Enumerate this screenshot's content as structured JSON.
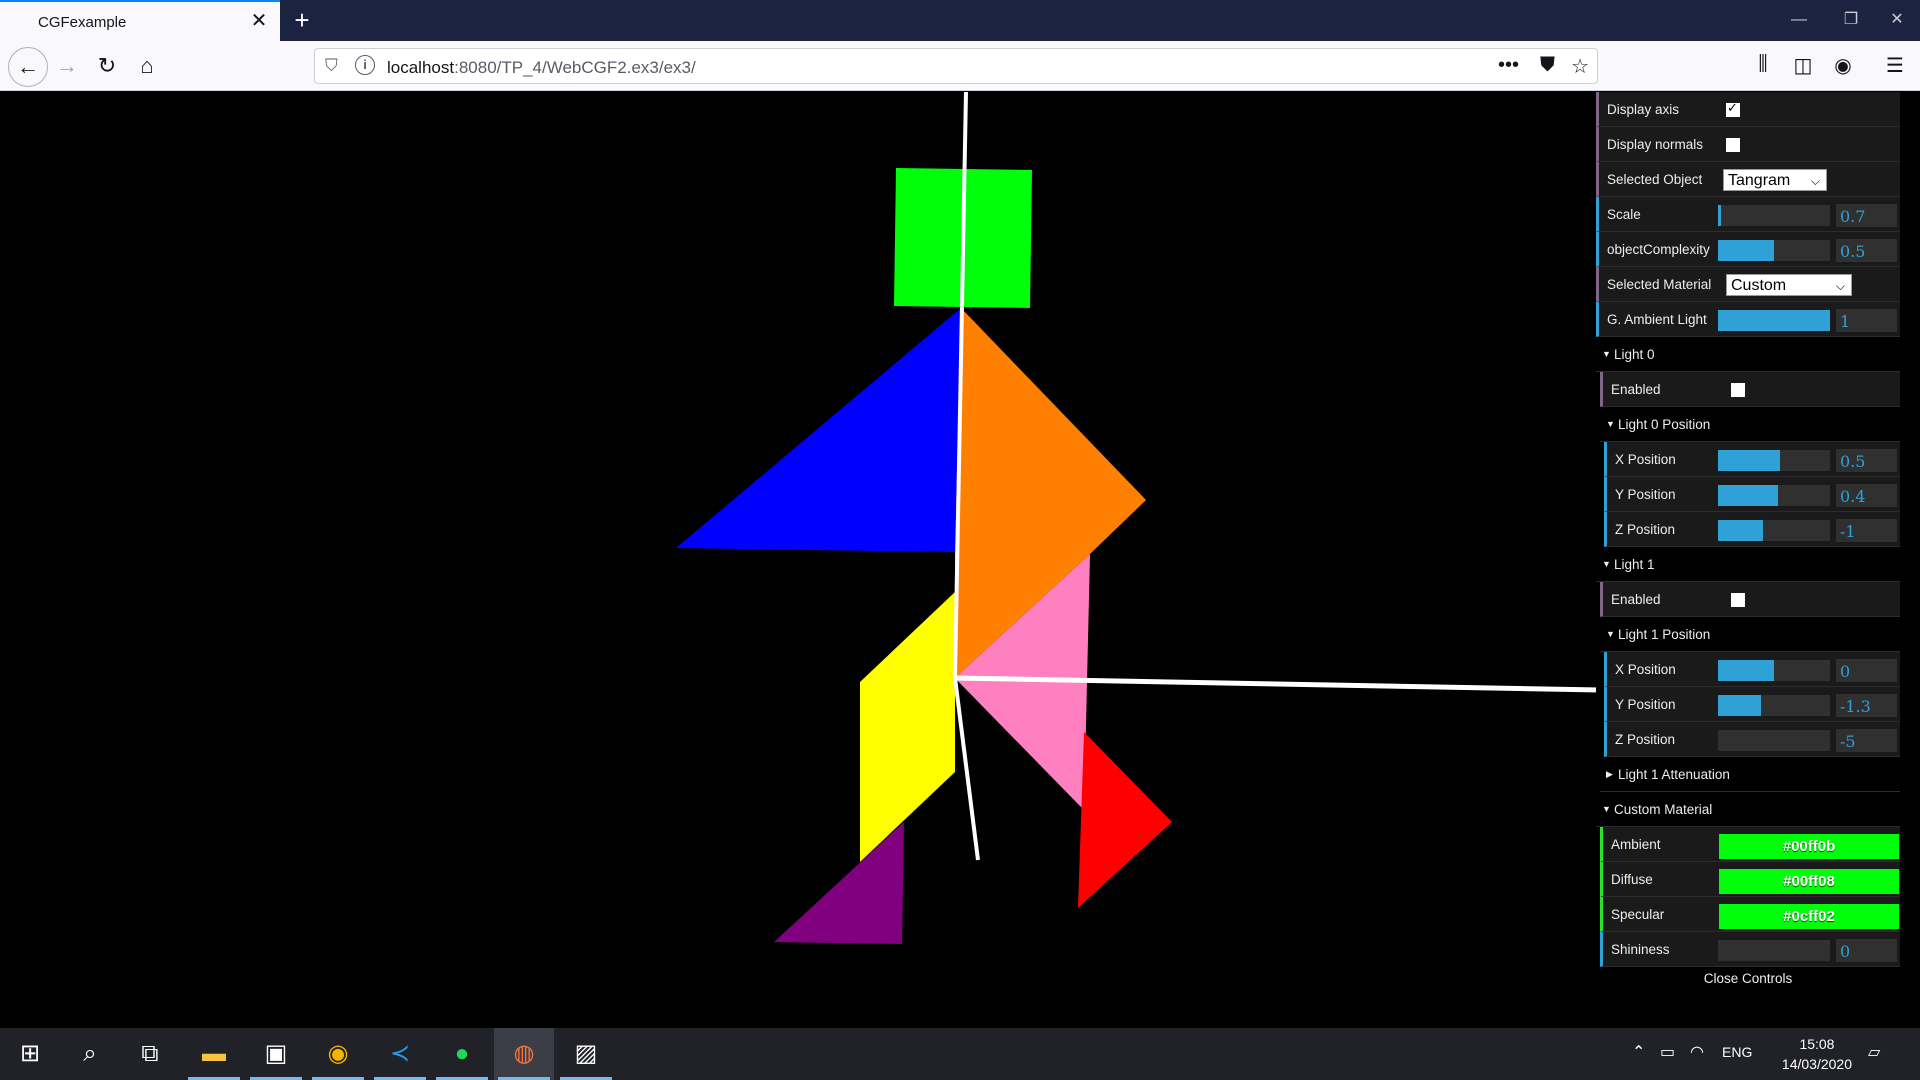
{
  "browser": {
    "tab_title": "CGFexample",
    "url_host": "localhost",
    "url_rest": ":8080/TP_4/WebCGF2.ex3/ex3/"
  },
  "scene": {
    "shapes": [
      "green-square",
      "blue-triangle",
      "orange-parallelogram",
      "pink-triangle",
      "yellow-parallelogram",
      "red-triangle",
      "purple-triangle"
    ]
  },
  "gui": {
    "display_axis": {
      "label": "Display axis",
      "checked": true
    },
    "display_normals": {
      "label": "Display normals",
      "checked": false
    },
    "selected_object": {
      "label": "Selected Object",
      "value": "Tangram"
    },
    "scale": {
      "label": "Scale",
      "value": "0.7",
      "fraction": 0.03
    },
    "object_complexity": {
      "label": "objectComplexity",
      "value": "0.5",
      "fraction": 0.5
    },
    "selected_material": {
      "label": "Selected Material",
      "value": "Custom"
    },
    "ambient_light": {
      "label": "G. Ambient Light",
      "value": "1",
      "fraction": 1.0
    },
    "light0": {
      "title": "Light 0",
      "enabled": {
        "label": "Enabled",
        "checked": false
      },
      "position_title": "Light 0 Position",
      "x": {
        "label": "X Position",
        "value": "0.5",
        "fraction": 0.55
      },
      "y": {
        "label": "Y Position",
        "value": "0.4",
        "fraction": 0.54
      },
      "z": {
        "label": "Z Position",
        "value": "-1",
        "fraction": 0.4
      }
    },
    "light1": {
      "title": "Light 1",
      "enabled": {
        "label": "Enabled",
        "checked": false
      },
      "position_title": "Light 1 Position",
      "x": {
        "label": "X Position",
        "value": "0",
        "fraction": 0.5
      },
      "y": {
        "label": "Y Position",
        "value": "-1.3",
        "fraction": 0.38
      },
      "z": {
        "label": "Z Position",
        "value": "-5",
        "fraction": 0.0
      },
      "attenuation_title": "Light 1 Attenuation"
    },
    "custom_material": {
      "title": "Custom Material",
      "ambient": {
        "label": "Ambient",
        "value": "#00ff0b"
      },
      "diffuse": {
        "label": "Diffuse",
        "value": "#00ff08"
      },
      "specular": {
        "label": "Specular",
        "value": "#0cff02"
      },
      "shininess": {
        "label": "Shininess",
        "value": "0",
        "fraction": 0.0
      }
    },
    "close_label": "Close Controls"
  },
  "taskbar": {
    "time": "15:08",
    "date": "14/03/2020",
    "language": "ENG"
  },
  "colors": {
    "accent": "#0a84ff",
    "slider": "#2fa1d6",
    "green": "#00ff0b",
    "blue": "#0000ff",
    "orange": "#ff8000",
    "pink": "#ff80c0",
    "yellow": "#ffff00",
    "red": "#ff0000",
    "purple": "#800080"
  }
}
